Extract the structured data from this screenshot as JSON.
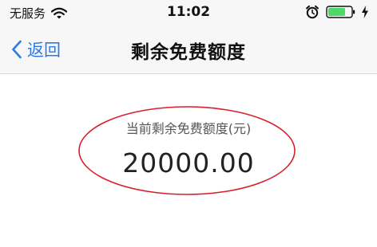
{
  "status_bar": {
    "carrier": "无服务",
    "time": "11:02",
    "wifi_icon": "wifi-icon",
    "alarm_icon": "alarm-icon",
    "battery_icon": "battery-icon",
    "charging_icon": "charging-bolt-icon",
    "battery_level": 0.75,
    "battery_color": "#4cd964"
  },
  "nav": {
    "back_label": "返回",
    "back_icon": "chevron-left-icon",
    "title": "剩余免费额度",
    "accent_color": "#2c7be5"
  },
  "quota": {
    "label": "当前剩余免费额度(元)",
    "value": "20000.00",
    "highlight_color": "#d81e2c"
  }
}
